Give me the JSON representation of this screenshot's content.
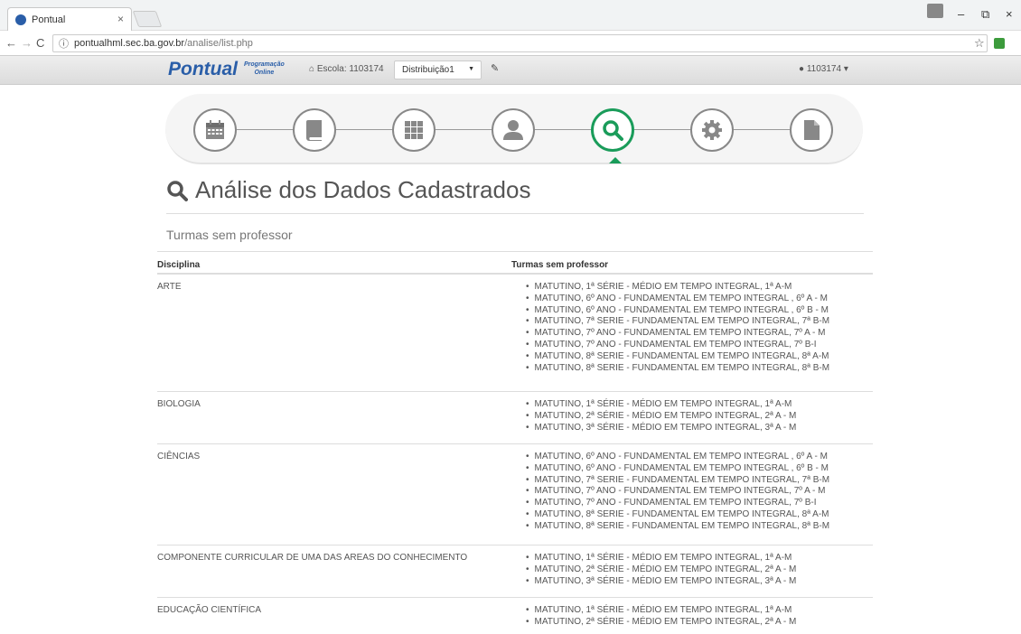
{
  "browser": {
    "tab_title": "Pontual",
    "tab_close": "×",
    "url_host": "pontualhml.sec.ba.gov.br",
    "url_path": "/analise/list.php",
    "win_min": "–",
    "win_max": "⧉",
    "win_close": "×"
  },
  "appnav": {
    "brand": "Pontual",
    "brand_sub1": "Programação",
    "brand_sub2": "Online",
    "escola_label": "Escola: 1103174",
    "distribution_selected": "Distribuição1",
    "user": "1103174"
  },
  "wizard": {
    "steps": [
      {
        "name": "calendar-step",
        "icon": "calendar-icon"
      },
      {
        "name": "book-step",
        "icon": "book-icon"
      },
      {
        "name": "grid-step",
        "icon": "grid-icon"
      },
      {
        "name": "user-step",
        "icon": "user-icon"
      },
      {
        "name": "search-step",
        "icon": "search-icon",
        "active": true
      },
      {
        "name": "settings-step",
        "icon": "gear-icon"
      },
      {
        "name": "file-step",
        "icon": "file-icon"
      }
    ],
    "active_color": "#1a9c5a"
  },
  "page": {
    "title": "Análise dos Dados Cadastrados",
    "subtitle": "Turmas sem professor"
  },
  "table": {
    "col_disciplina": "Disciplina",
    "col_turmas": "Turmas sem professor",
    "rows": [
      {
        "disciplina": "ARTE",
        "turmas": [
          "MATUTINO, 1ª SÉRIE - MÉDIO EM TEMPO INTEGRAL, 1ª A-M",
          "MATUTINO, 6º ANO - FUNDAMENTAL EM TEMPO INTEGRAL , 6º A - M",
          "MATUTINO, 6º ANO - FUNDAMENTAL EM TEMPO INTEGRAL , 6º B - M",
          "MATUTINO, 7ª SERIE - FUNDAMENTAL EM TEMPO INTEGRAL, 7ª B-M",
          "MATUTINO, 7º ANO - FUNDAMENTAL EM TEMPO INTEGRAL, 7º A - M",
          "MATUTINO, 7º ANO - FUNDAMENTAL EM TEMPO INTEGRAL, 7º B-I",
          "MATUTINO, 8ª SERIE - FUNDAMENTAL EM TEMPO INTEGRAL, 8ª A-M",
          "MATUTINO, 8ª SERIE - FUNDAMENTAL EM TEMPO INTEGRAL, 8ª B-M"
        ]
      },
      {
        "disciplina": "BIOLOGIA",
        "turmas": [
          "MATUTINO, 1ª SÉRIE - MÉDIO EM TEMPO INTEGRAL, 1ª A-M",
          "MATUTINO, 2ª SÉRIE - MÉDIO EM TEMPO INTEGRAL, 2ª A - M",
          "MATUTINO, 3ª SÉRIE - MÉDIO EM TEMPO INTEGRAL, 3ª A - M"
        ]
      },
      {
        "disciplina": "CIÊNCIAS",
        "turmas": [
          "MATUTINO, 6º ANO - FUNDAMENTAL EM TEMPO INTEGRAL , 6º A - M",
          "MATUTINO, 6º ANO - FUNDAMENTAL EM TEMPO INTEGRAL , 6º B - M",
          "MATUTINO, 7ª SERIE - FUNDAMENTAL EM TEMPO INTEGRAL, 7ª B-M",
          "MATUTINO, 7º ANO - FUNDAMENTAL EM TEMPO INTEGRAL, 7º A - M",
          "MATUTINO, 7º ANO - FUNDAMENTAL EM TEMPO INTEGRAL, 7º B-I",
          "MATUTINO, 8ª SERIE - FUNDAMENTAL EM TEMPO INTEGRAL, 8ª A-M",
          "MATUTINO, 8ª SERIE - FUNDAMENTAL EM TEMPO INTEGRAL, 8ª B-M"
        ]
      },
      {
        "disciplina": "COMPONENTE CURRICULAR DE UMA DAS AREAS DO CONHECIMENTO",
        "turmas": [
          "MATUTINO, 1ª SÉRIE - MÉDIO EM TEMPO INTEGRAL, 1ª A-M",
          "MATUTINO, 2ª SÉRIE - MÉDIO EM TEMPO INTEGRAL, 2ª A - M",
          "MATUTINO, 3ª SÉRIE - MÉDIO EM TEMPO INTEGRAL, 3ª A - M"
        ]
      },
      {
        "disciplina": "EDUCAÇÃO CIENTÍFICA",
        "turmas": [
          "MATUTINO, 1ª SÉRIE - MÉDIO EM TEMPO INTEGRAL, 1ª A-M",
          "MATUTINO, 2ª SÉRIE - MÉDIO EM TEMPO INTEGRAL, 2ª A - M"
        ]
      }
    ]
  }
}
